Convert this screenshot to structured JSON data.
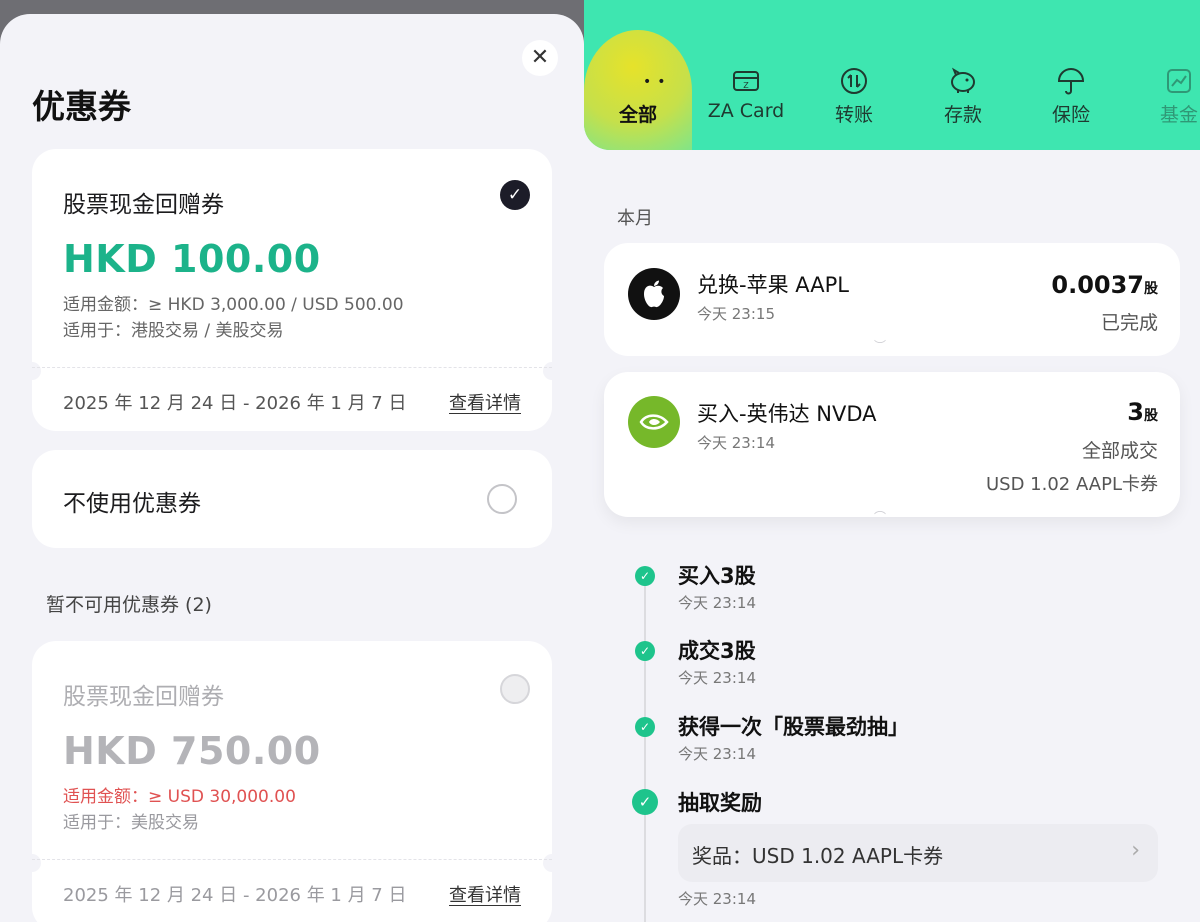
{
  "left_panel": {
    "title": "优惠券",
    "close_icon": "close-icon",
    "selected_coupon": {
      "name": "股票现金回赠券",
      "amount": "HKD 100.00",
      "min_spend": "适用金额：≥ HKD 3,000.00 / USD 500.00",
      "applicable": "适用于：港股交易 / 美股交易",
      "validity": "2025 年 12 月 24 日 - 2026 年 1 月 7 日",
      "detail_link": "查看详情",
      "selected": true
    },
    "no_coupon_option": "不使用优惠券",
    "unavailable_section": "暂不可用优惠券 (2)",
    "unavailable_coupon": {
      "name": "股票现金回赠券",
      "amount": "HKD 750.00",
      "min_spend": "适用金额：≥ USD 30,000.00",
      "applicable": "适用于：美股交易",
      "validity": "2025 年 12 月 24 日 - 2026 年 1 月 7 日",
      "detail_link": "查看详情"
    }
  },
  "right_panel": {
    "tabs": [
      {
        "label": "全部",
        "icon": "face-icon",
        "active": true
      },
      {
        "label": "ZA Card",
        "icon": "card-icon"
      },
      {
        "label": "转账",
        "icon": "transfer-icon"
      },
      {
        "label": "存款",
        "icon": "piggy-bank-icon"
      },
      {
        "label": "保险",
        "icon": "umbrella-icon"
      },
      {
        "label": "基金",
        "icon": "chart-icon"
      }
    ],
    "month_label": "本月",
    "transactions": [
      {
        "title": "兑换-苹果 AAPL",
        "time": "今天 23:15",
        "amount": "0.0037",
        "unit": "股",
        "status": "已完成",
        "icon": "apple-logo-icon"
      },
      {
        "title": "买入-英伟达 NVDA",
        "time": "今天 23:14",
        "amount": "3",
        "unit": "股",
        "status": "全部成交",
        "coupon": "USD 1.02 AAPL卡券",
        "icon": "nvidia-logo-icon"
      }
    ],
    "timeline": [
      {
        "title": "买入3股",
        "time": "今天 23:14"
      },
      {
        "title": "成交3股",
        "time": "今天 23:14"
      },
      {
        "title": "获得一次「股票最劲抽」",
        "time": "今天 23:14"
      },
      {
        "title": "抽取奖励",
        "time": "今天 23:14",
        "prize": "奖品：USD 1.02 AAPL卡券"
      }
    ]
  },
  "colors": {
    "accent_green": "#1cb38a",
    "topbar_green": "#3ee6b0",
    "warning_red": "#e05252",
    "status_dot": "#1ec48c"
  }
}
